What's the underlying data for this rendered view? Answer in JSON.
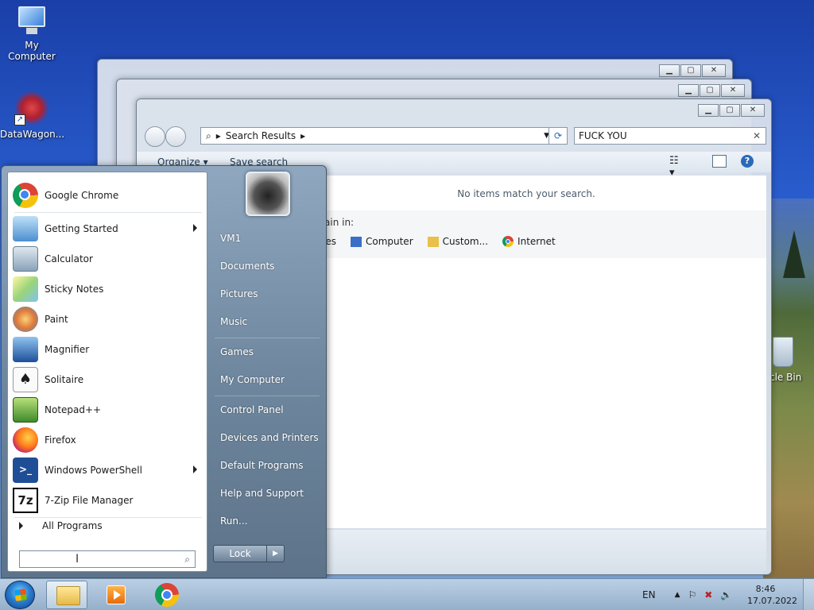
{
  "desktop": {
    "icons": [
      {
        "label": "My Computer"
      },
      {
        "label": "DataWagon..."
      },
      {
        "label": "cle Bin"
      }
    ]
  },
  "explorer": {
    "address": "Search Results",
    "search_value": "FUCK YOU",
    "toolbar": {
      "organize": "Organize",
      "save_search": "Save search"
    },
    "no_items": "No items match your search.",
    "search_again_label": "ain in:",
    "search_again_items": [
      "ies",
      "Computer",
      "Custom...",
      "Internet"
    ]
  },
  "start_menu": {
    "programs": [
      {
        "label": "Google Chrome",
        "submenu": false
      },
      {
        "label": "Getting Started",
        "submenu": true
      },
      {
        "label": "Calculator",
        "submenu": false
      },
      {
        "label": "Sticky Notes",
        "submenu": false
      },
      {
        "label": "Paint",
        "submenu": false
      },
      {
        "label": "Magnifier",
        "submenu": false
      },
      {
        "label": "Solitaire",
        "submenu": false
      },
      {
        "label": "Notepad++",
        "submenu": false
      },
      {
        "label": "Firefox",
        "submenu": false
      },
      {
        "label": "Windows PowerShell",
        "submenu": true
      },
      {
        "label": "7-Zip File Manager",
        "submenu": false
      }
    ],
    "all_programs": "All Programs",
    "right_items": [
      "VM1",
      "Documents",
      "Pictures",
      "Music",
      "Games",
      "My Computer",
      "Control Panel",
      "Devices and Printers",
      "Default Programs",
      "Help and Support",
      "Run..."
    ],
    "lock_label": "Lock"
  },
  "taskbar": {
    "language": "EN",
    "time": "8:46",
    "date": "17.07.2022"
  },
  "icons": {
    "minimize": "minimize-icon",
    "maximize": "maximize-icon",
    "close": "close-icon"
  }
}
